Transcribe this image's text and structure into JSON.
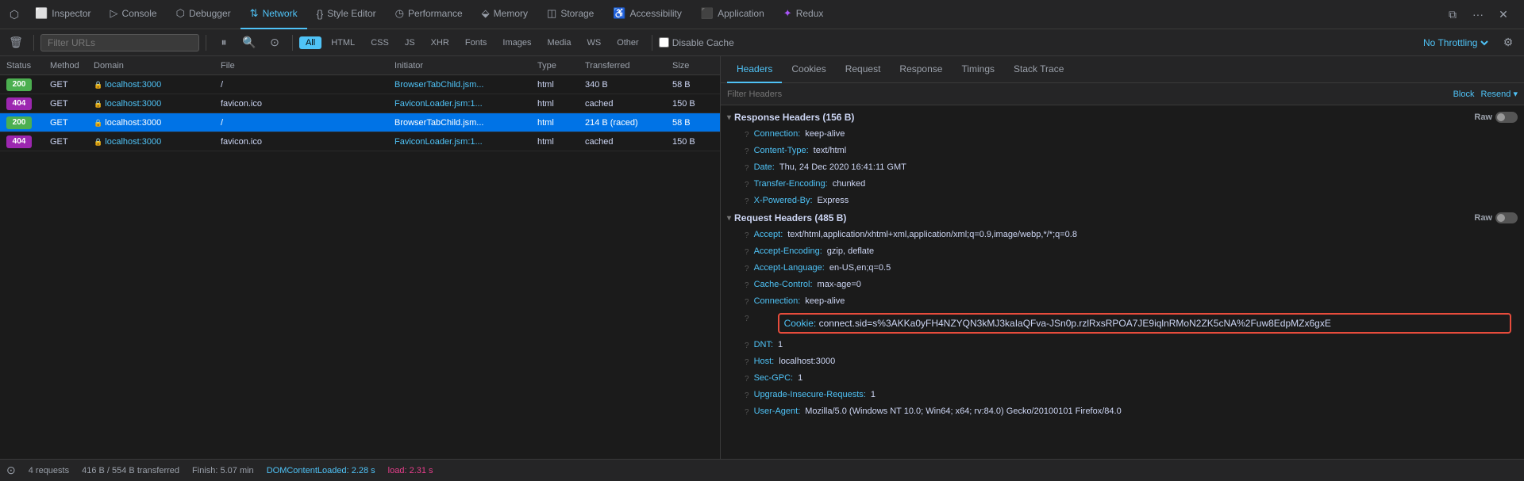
{
  "tabs": [
    {
      "id": "inspector",
      "label": "Inspector",
      "icon": "⬜",
      "active": false
    },
    {
      "id": "console",
      "label": "Console",
      "icon": "▷",
      "active": false
    },
    {
      "id": "debugger",
      "label": "Debugger",
      "icon": "⬡",
      "active": false
    },
    {
      "id": "network",
      "label": "Network",
      "icon": "↕",
      "active": true
    },
    {
      "id": "style-editor",
      "label": "Style Editor",
      "icon": "{}",
      "active": false
    },
    {
      "id": "performance",
      "label": "Performance",
      "icon": "◷",
      "active": false
    },
    {
      "id": "memory",
      "label": "Memory",
      "icon": "◫",
      "active": false
    },
    {
      "id": "storage",
      "label": "Storage",
      "icon": "◫",
      "active": false
    },
    {
      "id": "accessibility",
      "label": "Accessibility",
      "icon": "♿",
      "active": false
    },
    {
      "id": "application",
      "label": "Application",
      "icon": "⬛",
      "active": false
    },
    {
      "id": "redux",
      "label": "Redux",
      "icon": "✦",
      "active": false
    }
  ],
  "toolbar": {
    "filter_placeholder": "Filter URLs",
    "filter_tags": [
      "All",
      "HTML",
      "CSS",
      "JS",
      "XHR",
      "Fonts",
      "Images",
      "Media",
      "WS",
      "Other"
    ],
    "active_filter": "All",
    "disable_cache_label": "Disable Cache",
    "throttle_label": "No Throttling"
  },
  "table": {
    "columns": [
      "Status",
      "Method",
      "Domain",
      "File",
      "Initiator",
      "Type",
      "Transferred",
      "Size"
    ],
    "rows": [
      {
        "status": "200",
        "status_type": "200",
        "method": "GET",
        "lock": true,
        "domain": "localhost:3000",
        "file": "/",
        "initiator": "BrowserTabChild.jsm...",
        "type": "html",
        "transferred": "340 B",
        "size": "58 B",
        "selected": false
      },
      {
        "status": "404",
        "status_type": "404",
        "method": "GET",
        "lock": true,
        "domain": "localhost:3000",
        "file": "favicon.ico",
        "initiator": "FaviconLoader.jsm:1...",
        "type": "html",
        "transferred": "cached",
        "size": "150 B",
        "selected": false
      },
      {
        "status": "200",
        "status_type": "200",
        "method": "GET",
        "lock": true,
        "domain": "localhost:3000",
        "file": "/",
        "initiator": "BrowserTabChild.jsm...",
        "type": "html",
        "transferred": "214 B (raced)",
        "size": "58 B",
        "selected": true
      },
      {
        "status": "404",
        "status_type": "404",
        "method": "GET",
        "lock": true,
        "domain": "localhost:3000",
        "file": "favicon.ico",
        "initiator": "FaviconLoader.jsm:1...",
        "type": "html",
        "transferred": "cached",
        "size": "150 B",
        "selected": false
      }
    ]
  },
  "status_bar": {
    "requests": "4 requests",
    "transferred": "416 B / 554 B transferred",
    "finish": "Finish: 5.07 min",
    "dom_content_loaded": "DOMContentLoaded: 2.28 s",
    "load": "load: 2.31 s"
  },
  "right_panel": {
    "tabs": [
      "Headers",
      "Cookies",
      "Request",
      "Response",
      "Timings",
      "Stack Trace"
    ],
    "active_tab": "Headers",
    "filter_placeholder": "Filter Headers",
    "block_label": "Block",
    "resend_label": "Resend ▾",
    "response_headers": {
      "title": "Response Headers (156 B)",
      "headers": [
        {
          "name": "Connection:",
          "value": "keep-alive"
        },
        {
          "name": "Content-Type:",
          "value": "text/html"
        },
        {
          "name": "Date:",
          "value": "Thu, 24 Dec 2020 16:41:11 GMT"
        },
        {
          "name": "Transfer-Encoding:",
          "value": "chunked"
        },
        {
          "name": "X-Powered-By:",
          "value": "Express"
        }
      ]
    },
    "request_headers": {
      "title": "Request Headers (485 B)",
      "headers": [
        {
          "name": "Accept:",
          "value": "text/html,application/xhtml+xml,application/xml;q=0.9,image/webp,*/*;q=0.8",
          "is_cookie": false
        },
        {
          "name": "Accept-Encoding:",
          "value": "gzip, deflate",
          "is_cookie": false
        },
        {
          "name": "Accept-Language:",
          "value": "en-US,en;q=0.5",
          "is_cookie": false
        },
        {
          "name": "Cache-Control:",
          "value": "max-age=0",
          "is_cookie": false
        },
        {
          "name": "Connection:",
          "value": "keep-alive",
          "is_cookie": false
        },
        {
          "name": "Cookie:",
          "value": "connect.sid=s%3AKKa0yFH4NZYQN3kMJ3kaIaQFva-JSn0p.rzlRxsRPOA7JE9iqlnRMoN2ZK5cNA%2Fuw8EdpMZx6gxE",
          "is_cookie": true
        },
        {
          "name": "DNT:",
          "value": "1",
          "is_cookie": false
        },
        {
          "name": "Host:",
          "value": "localhost:3000",
          "is_cookie": false
        },
        {
          "name": "Sec-GPC:",
          "value": "1",
          "is_cookie": false
        },
        {
          "name": "Upgrade-Insecure-Requests:",
          "value": "1",
          "is_cookie": false
        },
        {
          "name": "User-Agent:",
          "value": "Mozilla/5.0 (Windows NT 10.0; Win64; x64; rv:84.0) Gecko/20100101 Firefox/84.0",
          "is_cookie": false
        }
      ]
    }
  }
}
